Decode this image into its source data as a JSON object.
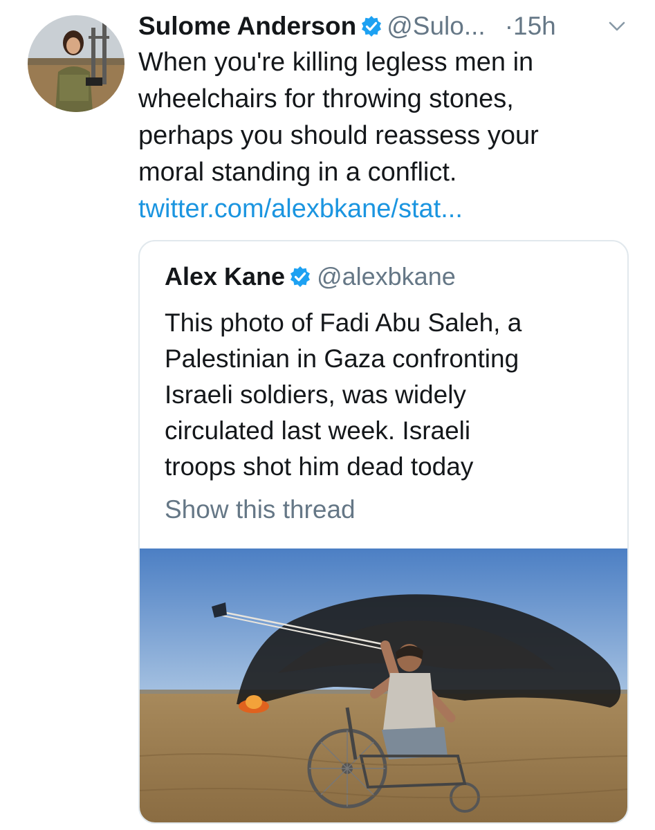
{
  "tweet": {
    "author": {
      "display_name": "Sulome Anderson",
      "handle": "@Sulo...",
      "verified": true,
      "avatar_icon": "user-avatar-photo"
    },
    "separator": "·",
    "time": "15h",
    "menu_icon": "chevron-down-icon",
    "text_lines": [
      "When you're killing legless men in",
      "wheelchairs for throwing stones,",
      "perhaps you should reassess your",
      "moral standing in a conflict."
    ],
    "link": "twitter.com/alexbkane/stat..."
  },
  "quoted_tweet": {
    "author": {
      "display_name": "Alex Kane",
      "handle": "@alexbkane",
      "verified": true
    },
    "text_lines": [
      "This photo of Fadi Abu Saleh, a",
      "Palestinian in Gaza confronting",
      "Israeli soldiers, was widely",
      "circulated last week. Israeli",
      "troops shot him dead today"
    ],
    "show_thread": "Show this thread",
    "photo_icon": "attached-photo"
  },
  "colors": {
    "text": "#14171a",
    "secondary": "#657786",
    "link": "#1b95e0",
    "verified": "#1da1f2",
    "border": "#e1e8ed"
  }
}
